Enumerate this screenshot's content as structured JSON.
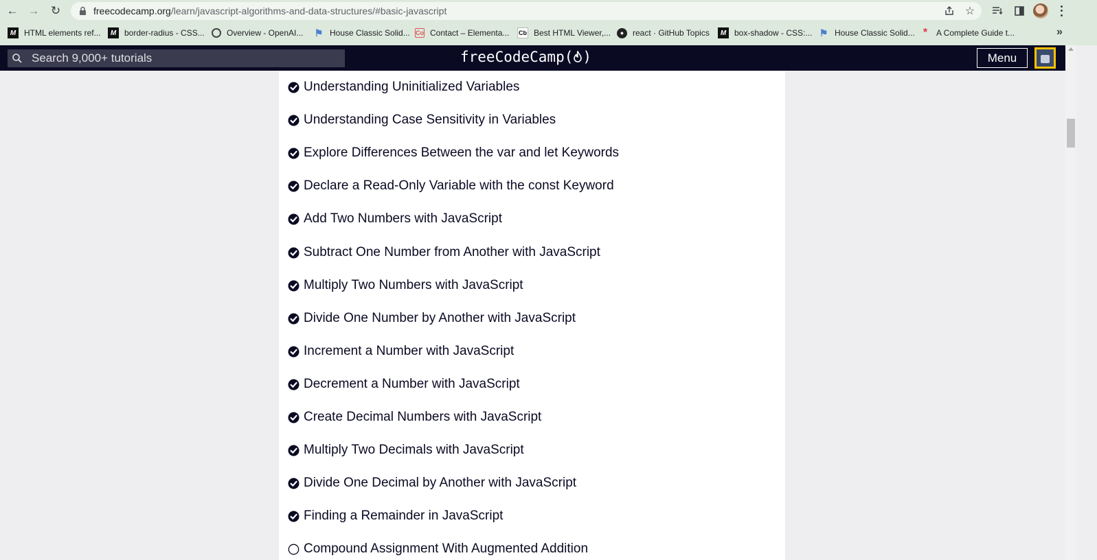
{
  "browser": {
    "url_host": "freecodecamp.org",
    "url_path": "/learn/javascript-algorithms-and-data-structures/#basic-javascript",
    "bookmarks": [
      {
        "label": "HTML elements ref...",
        "icon": "mdn-icon"
      },
      {
        "label": "border-radius - CSS...",
        "icon": "mdn-icon"
      },
      {
        "label": "Overview - OpenAI...",
        "icon": "openai-icon"
      },
      {
        "label": "House Classic Solid...",
        "icon": "flag-icon"
      },
      {
        "label": "Contact – Elementa...",
        "icon": "elementor-icon"
      },
      {
        "label": "Best HTML Viewer,...",
        "icon": "codebeautify-icon"
      },
      {
        "label": "react · GitHub Topics",
        "icon": "github-icon"
      },
      {
        "label": "box-shadow - CSS:...",
        "icon": "mdn-icon"
      },
      {
        "label": "House Classic Solid...",
        "icon": "flag-icon"
      },
      {
        "label": "A Complete Guide t...",
        "icon": "css-tricks-icon"
      }
    ]
  },
  "fcc_nav": {
    "search_placeholder": "Search 9,000+ tutorials",
    "logo_text": "freeCodeCamp(",
    "logo_close": ")",
    "menu_label": "Menu"
  },
  "lessons": [
    {
      "title": "Understanding Uninitialized Variables",
      "completed": true
    },
    {
      "title": "Understanding Case Sensitivity in Variables",
      "completed": true
    },
    {
      "title": "Explore Differences Between the var and let Keywords",
      "completed": true
    },
    {
      "title": "Declare a Read-Only Variable with the const Keyword",
      "completed": true
    },
    {
      "title": "Add Two Numbers with JavaScript",
      "completed": true
    },
    {
      "title": "Subtract One Number from Another with JavaScript",
      "completed": true
    },
    {
      "title": "Multiply Two Numbers with JavaScript",
      "completed": true
    },
    {
      "title": "Divide One Number by Another with JavaScript",
      "completed": true
    },
    {
      "title": "Increment a Number with JavaScript",
      "completed": true
    },
    {
      "title": "Decrement a Number with JavaScript",
      "completed": true
    },
    {
      "title": "Create Decimal Numbers with JavaScript",
      "completed": true
    },
    {
      "title": "Multiply Two Decimals with JavaScript",
      "completed": true
    },
    {
      "title": "Divide One Decimal by Another with JavaScript",
      "completed": true
    },
    {
      "title": "Finding a Remainder in JavaScript",
      "completed": true
    },
    {
      "title": "Compound Assignment With Augmented Addition",
      "completed": false
    }
  ],
  "colors": {
    "nav_bg": "#0a0a23",
    "search_bg": "#3b3b4f",
    "avatar_bg": "#ffc300",
    "page_bg": "#eeeef0",
    "content_bg": "#ffffff",
    "text": "#0a0a23"
  }
}
